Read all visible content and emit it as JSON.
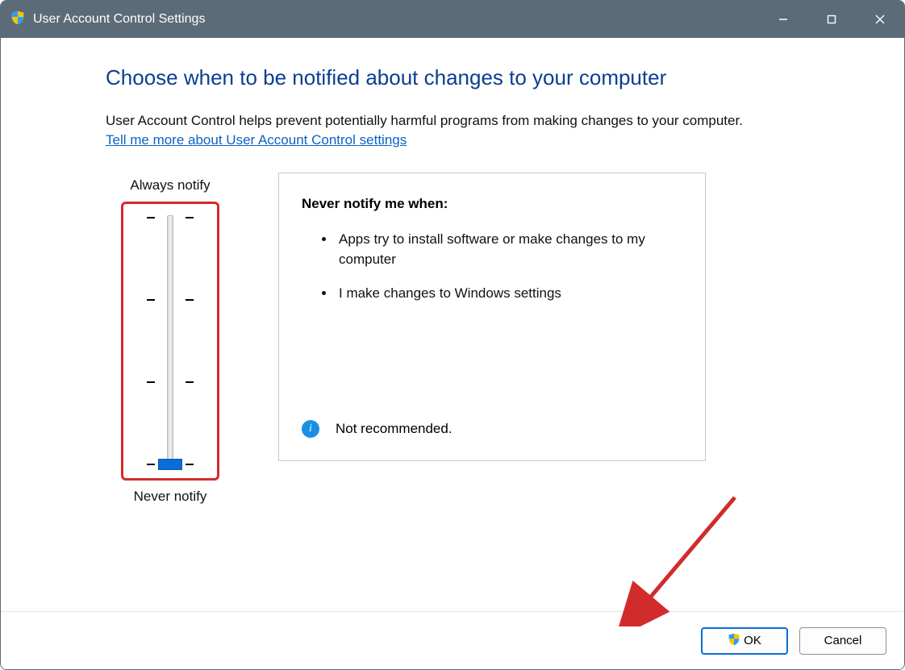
{
  "window": {
    "title": "User Account Control Settings"
  },
  "main": {
    "heading": "Choose when to be notified about changes to your computer",
    "description": "User Account Control helps prevent potentially harmful programs from making changes to your computer.",
    "help_link": "Tell me more about User Account Control settings"
  },
  "slider": {
    "top_label": "Always notify",
    "bottom_label": "Never notify",
    "levels": 4,
    "current_level": 0
  },
  "panel": {
    "heading": "Never notify me when:",
    "bullets": [
      "Apps try to install software or make changes to my computer",
      "I make changes to Windows settings"
    ],
    "recommendation": "Not recommended."
  },
  "footer": {
    "ok_label": "OK",
    "cancel_label": "Cancel"
  },
  "icons": {
    "shield": "shield-icon",
    "info": "info-icon"
  },
  "annotation": {
    "arrow_color": "#d22b2b"
  }
}
